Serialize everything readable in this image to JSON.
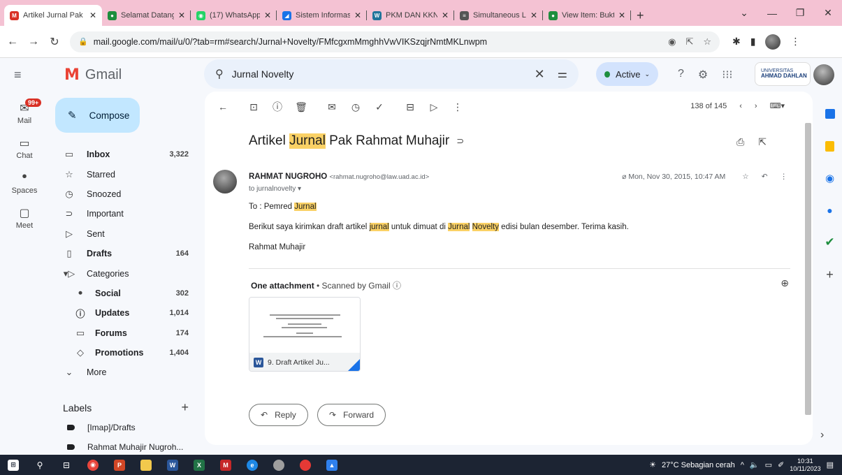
{
  "browser": {
    "tabs": [
      {
        "label": "Artikel Jurnal Pak",
        "color": "#d93025",
        "glyph": "M",
        "active": true
      },
      {
        "label": "Selamat Datang",
        "color": "#1e8e3e",
        "glyph": "●",
        "active": false
      },
      {
        "label": "(17) WhatsApp",
        "color": "#25d366",
        "glyph": "◉",
        "active": false
      },
      {
        "label": "Sistem Informasi",
        "color": "#1a73e8",
        "glyph": "◢",
        "active": false
      },
      {
        "label": "PKM DAN KKN",
        "color": "#21759b",
        "glyph": "W",
        "active": false
      },
      {
        "label": "Simultaneous Lo",
        "color": "#555555",
        "glyph": "≡",
        "active": false
      },
      {
        "label": "View Item: Bukti",
        "color": "#1e8e3e",
        "glyph": "●",
        "active": false
      }
    ],
    "url": "mail.google.com/mail/u/0/?tab=rm#search/Jurnal+Novelty/FMfcgxmMmghhVwVIKSzqjrNmtMKLnwpm"
  },
  "gmail": {
    "app_name": "Gmail",
    "search_query": "Jurnal Novelty",
    "status": "Active",
    "org_name_top": "UNIVERSITAS",
    "org_name": "AHMAD DAHLAN"
  },
  "rail": {
    "badge": "99+",
    "items": [
      "Mail",
      "Chat",
      "Spaces",
      "Meet"
    ]
  },
  "nav": {
    "compose": "Compose",
    "items": [
      {
        "label": "Inbox",
        "count": "3,322",
        "bold": true,
        "icon": "▭"
      },
      {
        "label": "Starred",
        "count": "",
        "bold": false,
        "icon": "☆"
      },
      {
        "label": "Snoozed",
        "count": "",
        "bold": false,
        "icon": "◷"
      },
      {
        "label": "Important",
        "count": "",
        "bold": false,
        "icon": "⊃"
      },
      {
        "label": "Sent",
        "count": "",
        "bold": false,
        "icon": "▷"
      },
      {
        "label": "Drafts",
        "count": "164",
        "bold": true,
        "icon": "▯"
      },
      {
        "label": "Categories",
        "count": "",
        "bold": false,
        "icon": "▾▷"
      }
    ],
    "categories": [
      {
        "label": "Social",
        "count": "302",
        "icon": "ꔷ"
      },
      {
        "label": "Updates",
        "count": "1,014",
        "icon": "ⓘ"
      },
      {
        "label": "Forums",
        "count": "174",
        "icon": "▭"
      },
      {
        "label": "Promotions",
        "count": "1,404",
        "icon": "◇"
      }
    ],
    "more": "More",
    "labels_heading": "Labels",
    "labels": [
      "[Imap]/Drafts",
      "Rahmat Muhajir Nugroh..."
    ]
  },
  "message": {
    "pager": "138 of 145",
    "subject_prefix": "Artikel ",
    "subject_highlight": "Jurnal",
    "subject_suffix": " Pak Rahmat Muhajir",
    "sender_name": "RAHMAT NUGROHO",
    "sender_email": "<rahmat.nugroho@law.uad.ac.id>",
    "to": "to jurnalnovelty ▾",
    "date": "Mon, Nov 30, 2015, 10:47 AM",
    "greeting_prefix": "To : Pemred ",
    "greeting_hl": "Jurnal",
    "body_a": "Berikut saya kirimkan draft artikel ",
    "body_hl1": "jurnal",
    "body_b": " untuk dimuat di ",
    "body_hl2": "Jurnal",
    "body_c": " ",
    "body_hl3": "Novelty",
    "body_d": " edisi bulan desember. Terima kasih.",
    "signature": "Rahmat Muhajir",
    "attachment_heading": "One attachment",
    "attachment_scan": " • Scanned by Gmail ⓘ",
    "attachment_name": "9. Draft Artikel Ju...",
    "reply": "Reply",
    "forward": "Forward"
  },
  "taskbar": {
    "weather": "27°C  Sebagian cerah",
    "time": "10:31",
    "date": "10/11/2023"
  }
}
